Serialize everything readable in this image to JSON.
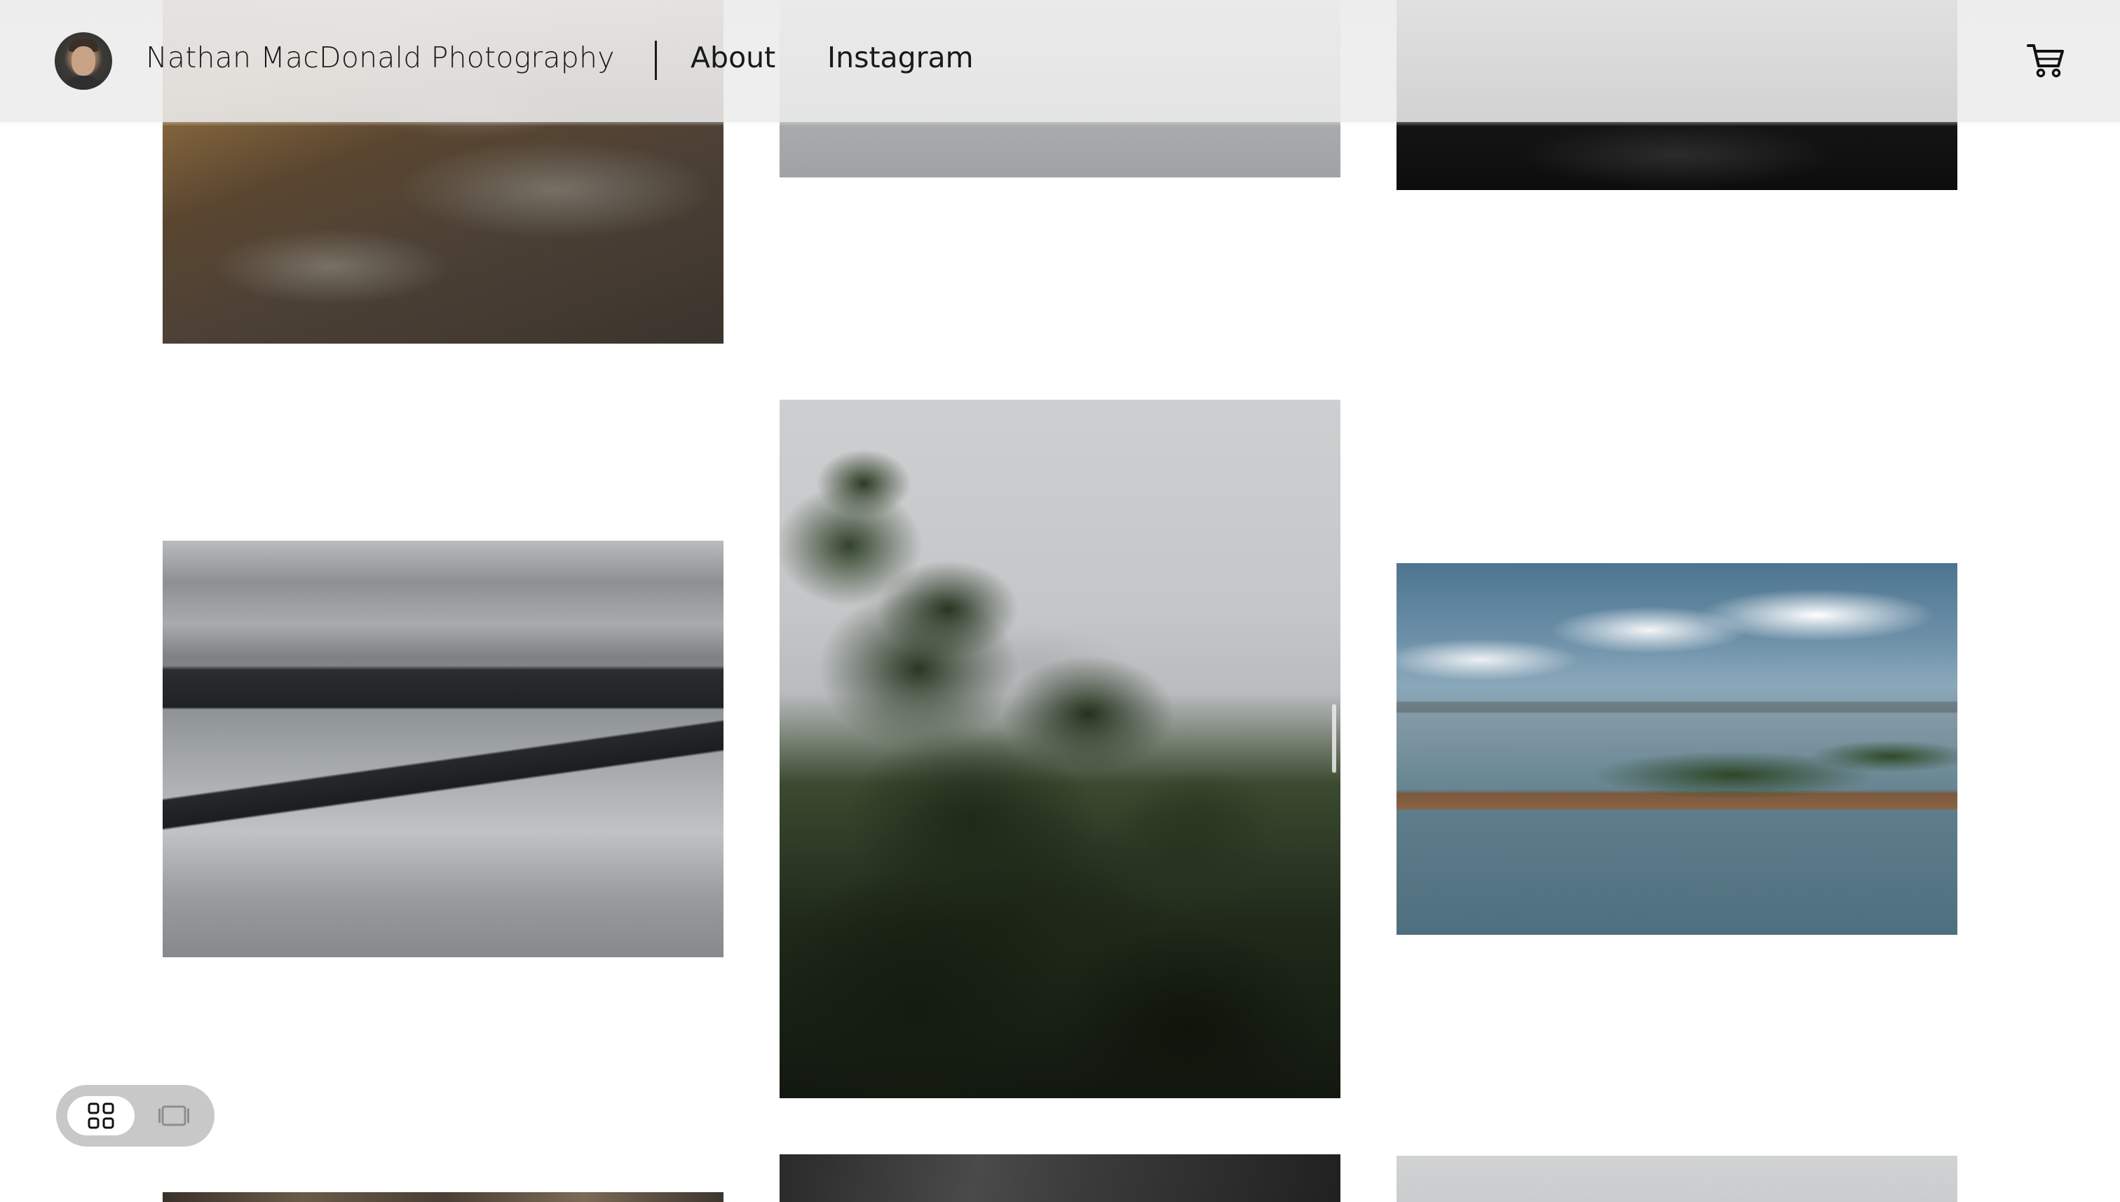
{
  "header": {
    "site_title": "Nathan MacDonald Photography",
    "nav": {
      "about": "About",
      "instagram": "Instagram"
    },
    "avatar_icon": "profile-photo",
    "cart_icon": "shopping-cart-icon"
  },
  "gallery": {
    "layout": "masonry-3-column",
    "photos": [
      {
        "subject": "rocky grassy hillside",
        "column": 1
      },
      {
        "subject": "dark headland over grey sea",
        "column": 1
      },
      {
        "subject": "rocky shore",
        "column": 1
      },
      {
        "subject": "grey sea surface",
        "column": 2
      },
      {
        "subject": "apple tree leaves against overcast sky",
        "column": 2
      },
      {
        "subject": "dark sky",
        "column": 2
      },
      {
        "subject": "dark water at night",
        "column": 3
      },
      {
        "subject": "forested island in blue bay",
        "column": 3
      },
      {
        "subject": "pale grey sky",
        "column": 3
      }
    ]
  },
  "view_toggle": {
    "options": [
      "grid-view-icon",
      "single-view-icon"
    ],
    "selected": "grid-view-icon"
  },
  "colors": {
    "text": "#1a1a1a",
    "header_background": "#ececec",
    "toggle_background": "#bebebe",
    "toggle_active": "#ffffff"
  }
}
